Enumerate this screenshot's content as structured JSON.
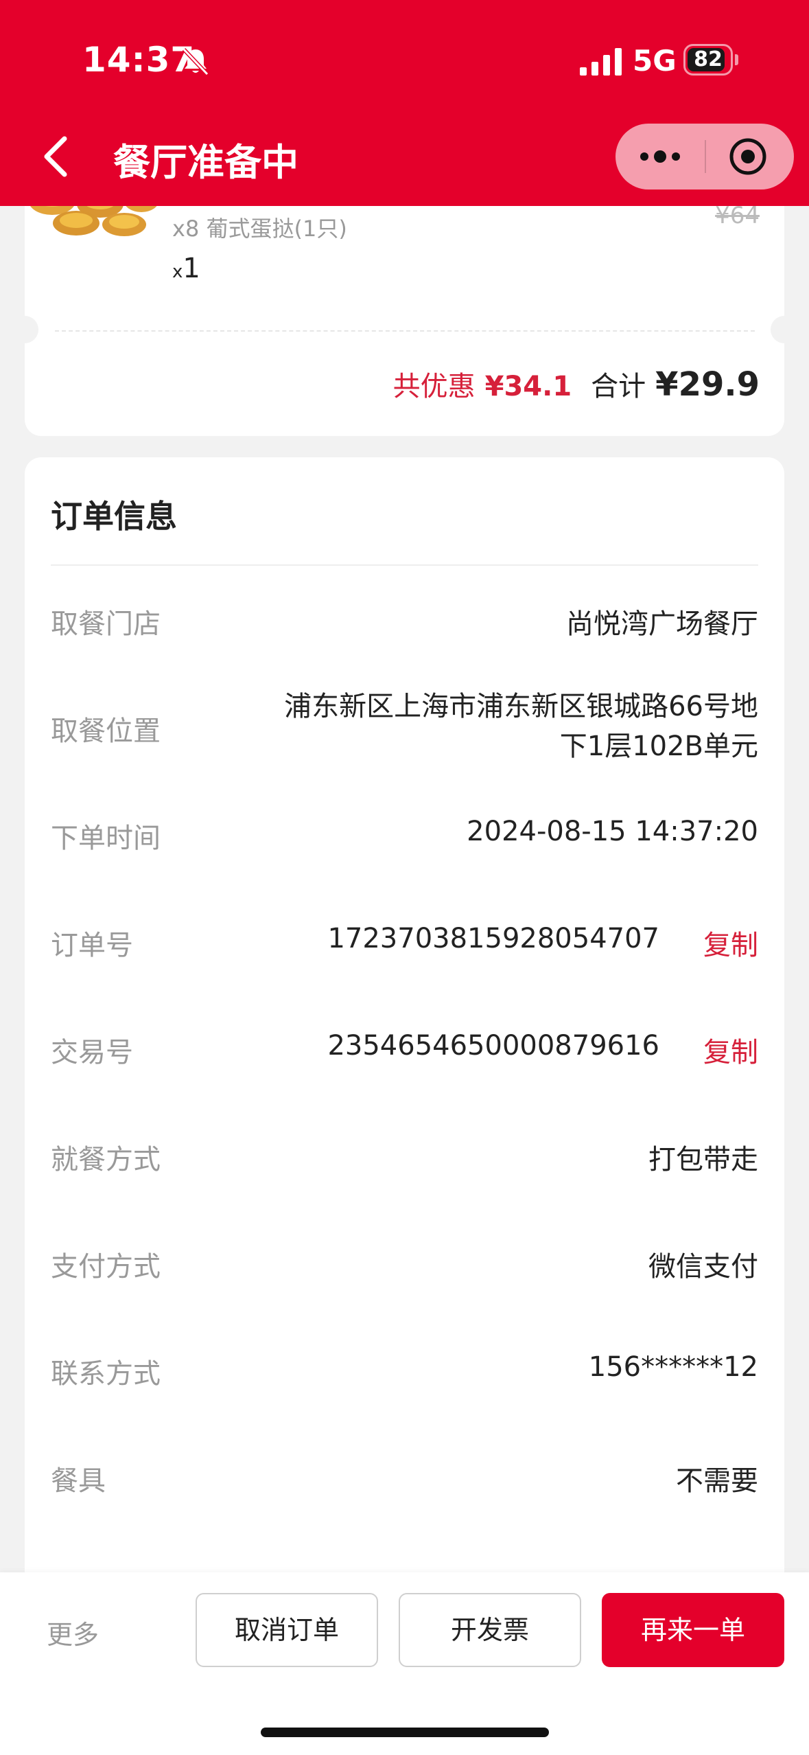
{
  "status_bar": {
    "time": "14:37",
    "network": "5G",
    "battery": "82",
    "battery_level": 0.82
  },
  "nav": {
    "title": "餐厅准备中"
  },
  "order_item": {
    "description": "x8 葡式蛋挞(1只)",
    "qty_prefix": "x",
    "qty": "1",
    "original_price": "¥64"
  },
  "totals": {
    "discount_label": "共优惠",
    "discount_value": "¥34.1",
    "total_label": "合计",
    "total_value": "¥29.9"
  },
  "order_info": {
    "title": "订单信息",
    "rows": [
      {
        "label": "取餐门店",
        "value": "尚悦湾广场餐厅"
      },
      {
        "label": "取餐位置",
        "value": "浦东新区上海市浦东新区银城路66号地下1层102B单元"
      },
      {
        "label": "下单时间",
        "value": "2024-08-15 14:37:20"
      },
      {
        "label": "订单号",
        "value": "1723703815928054707",
        "action": "复制"
      },
      {
        "label": "交易号",
        "value": "2354654650000879616",
        "action": "复制"
      },
      {
        "label": "就餐方式",
        "value": "打包带走"
      },
      {
        "label": "支付方式",
        "value": "微信支付"
      },
      {
        "label": "联系方式",
        "value": "156******12"
      },
      {
        "label": "餐具",
        "value": "不需要"
      }
    ]
  },
  "bottom_bar": {
    "more": "更多",
    "cancel": "取消订单",
    "invoice": "开发票",
    "reorder": "再来一单"
  },
  "colors": {
    "brand_red": "#e4002b",
    "price_red": "#d6203a"
  }
}
